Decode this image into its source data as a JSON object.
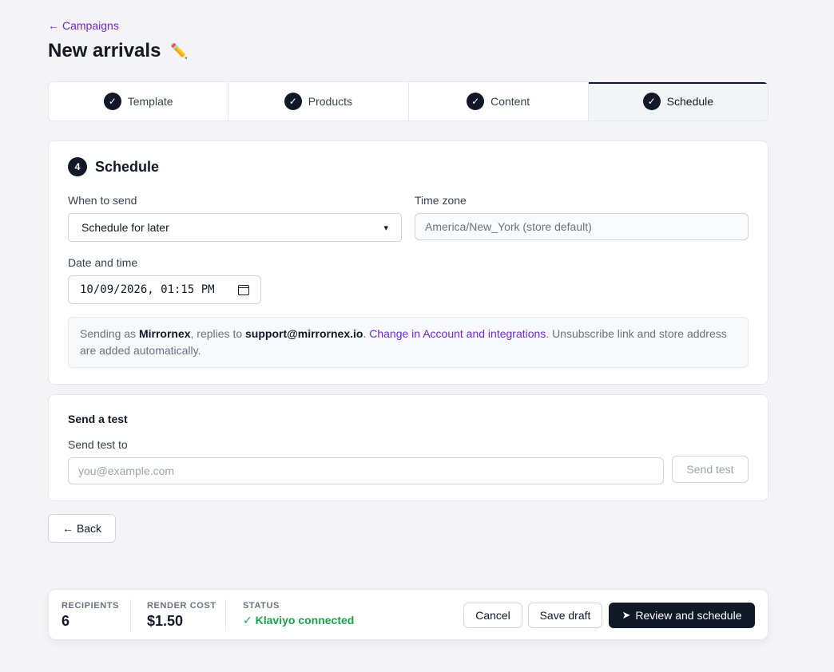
{
  "breadcrumb": {
    "arrow": "←",
    "label": "Campaigns"
  },
  "title": "New arrivals",
  "title_icon": "pencil-icon",
  "steps": [
    {
      "label": "Template",
      "done": true
    },
    {
      "label": "Products",
      "done": true
    },
    {
      "label": "Content",
      "done": true
    },
    {
      "label": "Schedule",
      "done": true,
      "active": true
    }
  ],
  "schedule": {
    "number": "4",
    "title": "Schedule",
    "when_label": "When to send",
    "when_value": "Schedule for later",
    "tz_label": "Time zone",
    "tz_value": "America/New_York (store default)",
    "date_label": "Date and time",
    "date_value": "10/09/2026, 01:15 PM",
    "notice": {
      "pre": "Sending as ",
      "sender": "Mirrornex",
      "mid": ", replies to ",
      "reply": "support@mirrornex.io",
      "dot": ". ",
      "link": "Change in Account and integrations",
      "post": ". Unsubscribe link and store address are added automatically."
    }
  },
  "test": {
    "title": "Send a test",
    "label": "Send test to",
    "placeholder": "you@example.com",
    "button": "Send test"
  },
  "back_button": "Back",
  "footer": {
    "recipients_label": "RECIPIENTS",
    "recipients_value": "6",
    "cost_label": "RENDER COST",
    "cost_value": "$1.50",
    "status_label": "STATUS",
    "status_value": "Klaviyo connected",
    "cancel": "Cancel",
    "save_draft": "Save draft",
    "review": "Review and schedule"
  },
  "colors": {
    "accent": "#6d28d9",
    "primary": "#111827",
    "success": "#16a34a"
  }
}
